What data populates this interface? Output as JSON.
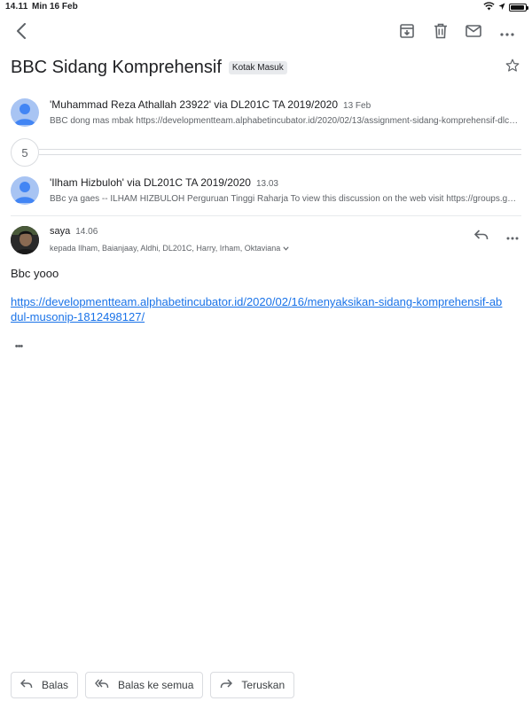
{
  "status": {
    "time": "14.11",
    "date": "Min 16 Feb",
    "battery_level": 0.92
  },
  "toolbar": {
    "icons": [
      "back-arrow-icon",
      "archive-icon",
      "trash-icon",
      "mail-icon",
      "more-icon"
    ]
  },
  "thread": {
    "subject": "BBC Sidang Komprehensif",
    "label": "Kotak Masuk",
    "hidden_count": "5"
  },
  "messages": [
    {
      "from": "'Muhammad Reza Athallah 23922' via DL201C TA 2019/2020",
      "time": "13 Feb",
      "snippet": "BBC dong mas mbak https://developmentteam.alphabetincubator.id/2020/02/13/assignment-sidang-komprehensif-dlc-2020/"
    },
    {
      "from": "'Ilham Hizbuloh' via DL201C TA 2019/2020",
      "time": "13.03",
      "snippet": "BBc ya gaes -- ILHAM HIZBULOH Perguruan Tinggi Raharja To view this discussion on the web visit https://groups.google.com/"
    }
  ],
  "open_message": {
    "from": "saya",
    "time": "14.06",
    "to": "kepada Ilham, Baianjaay, Aldhi, DL201C, Harry, Irham, Oktaviana",
    "body": "Bbc yooo",
    "link": "https://developmentteam.alphabetincubator.id/2020/02/16/menyaksikan-sidang-komprehensif-abdul-musonip-1812498127/",
    "trimmed": "•••"
  },
  "actions": {
    "reply": "Balas",
    "reply_all": "Balas ke semua",
    "forward": "Teruskan"
  },
  "colors": {
    "accent_link": "#1a73e8",
    "avatar_default": "#a8c4f3",
    "avatar_person": "#4285f4"
  }
}
